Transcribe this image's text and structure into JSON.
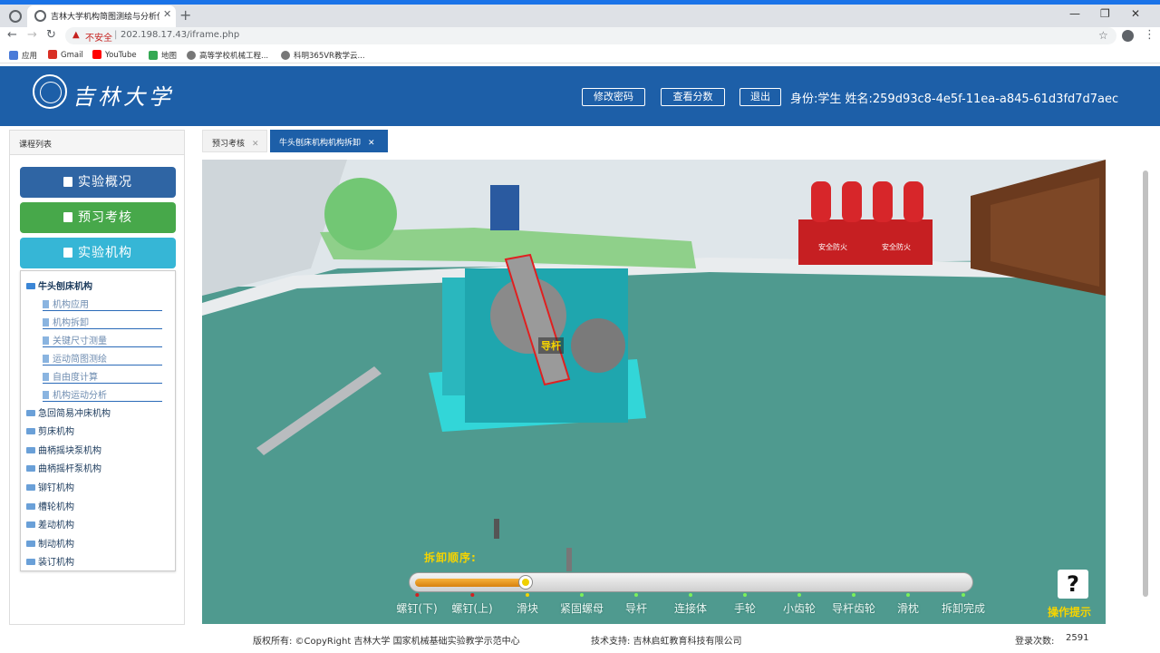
{
  "browser": {
    "tab_title": "吉林大学机构简图测绘与分析仿真",
    "insecure_label": "不安全",
    "url": "202.198.17.43/iframe.php",
    "bookmarks": [
      "应用",
      "Gmail",
      "YouTube",
      "地图",
      "高等学校机械工程...",
      "科明365VR教学云..."
    ]
  },
  "header": {
    "logo_text": "吉林大学",
    "buttons": [
      "修改密码",
      "查看分数",
      "退出"
    ],
    "identity": "身份:学生   姓名:259d93c8-4e5f-11ea-a845-61d3fd7d7aec",
    "brand_color": "#1d5fa8"
  },
  "sidebar": {
    "title": "课程列表",
    "buttons": [
      {
        "label": "实验概况",
        "color": "#2f65a4"
      },
      {
        "label": "预习考核",
        "color": "#47a84a"
      },
      {
        "label": "实验机构",
        "color": "#36b6d6"
      }
    ],
    "tree": {
      "expanded": "牛头刨床机构",
      "children": [
        "机构应用",
        "机构拆卸",
        "关键尺寸测量",
        "运动简图测绘",
        "自由度计算",
        "机构运动分析"
      ],
      "others": [
        "急回简易冲床机构",
        "剪床机构",
        "曲柄摇块泵机构",
        "曲柄摇杆泵机构",
        "铆钉机构",
        "槽轮机构",
        "差动机构",
        "制动机构",
        "装订机构"
      ]
    }
  },
  "tabs": [
    {
      "label": "预习考核",
      "active": false
    },
    {
      "label": "牛头刨床机构机构拆卸",
      "active": true
    }
  ],
  "viewport": {
    "part_label": "导杆",
    "order_label": "拆卸顺序:",
    "progress_fraction": 0.2,
    "steps": [
      {
        "label": "螺钉(下)",
        "dot": "#d42020"
      },
      {
        "label": "螺钉(上)",
        "dot": "#d42020"
      },
      {
        "label": "滑块",
        "dot": "#f5d400"
      },
      {
        "label": "紧固螺母",
        "dot": "#7cf05a"
      },
      {
        "label": "导杆",
        "dot": "#7cf05a"
      },
      {
        "label": "连接体",
        "dot": "#7cf05a"
      },
      {
        "label": "手轮",
        "dot": "#7cf05a"
      },
      {
        "label": "小齿轮",
        "dot": "#7cf05a"
      },
      {
        "label": "导杆齿轮",
        "dot": "#7cf05a"
      },
      {
        "label": "滑枕",
        "dot": "#7cf05a"
      },
      {
        "label": "拆卸完成",
        "dot": "#7cf05a"
      }
    ],
    "help_icon": "?",
    "help_label": "操作提示",
    "extinguisher_label": "安全防火"
  },
  "footer": {
    "copyright": "版权所有:  ©CopyRight 吉林大学  国家机械基础实验教学示范中心",
    "support": "技术支持:  吉林启虹教育科技有限公司",
    "login_count_label": "登录次数:",
    "login_count": "2591"
  }
}
